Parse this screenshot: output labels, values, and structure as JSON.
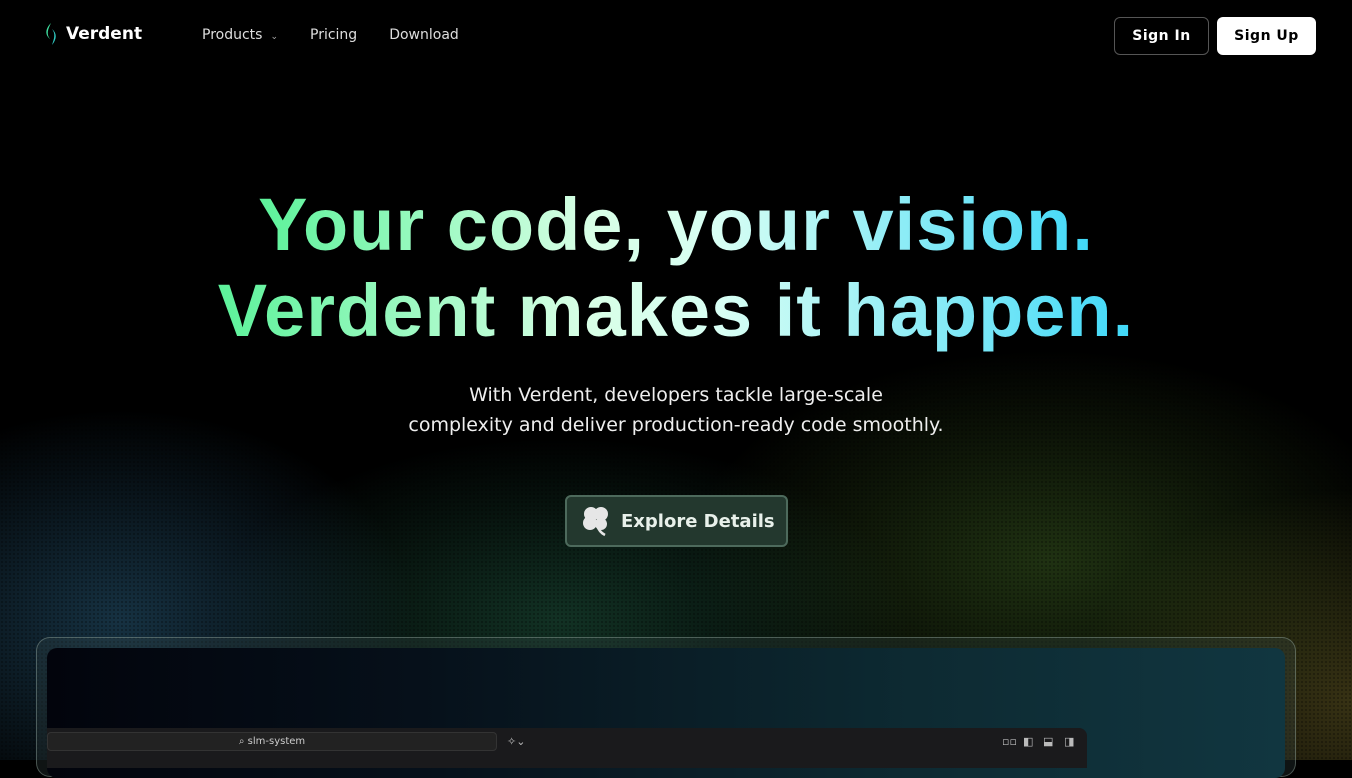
{
  "nav": {
    "brand": "Verdent",
    "links": [
      "Products",
      "Pricing",
      "Download"
    ],
    "sign_in": "Sign In",
    "sign_up": "Sign Up"
  },
  "hero": {
    "line1": "Your code, your vision.",
    "line2": "Verdent makes it happen.",
    "sub1": "With Verdent, developers tackle large-scale",
    "sub2": "complexity and deliver production-ready code smoothly.",
    "cta": "Explore Details"
  },
  "preview": {
    "search": "slm-system"
  },
  "colors": {
    "green": "#5cf29a",
    "cyan": "#3fd8f8"
  }
}
